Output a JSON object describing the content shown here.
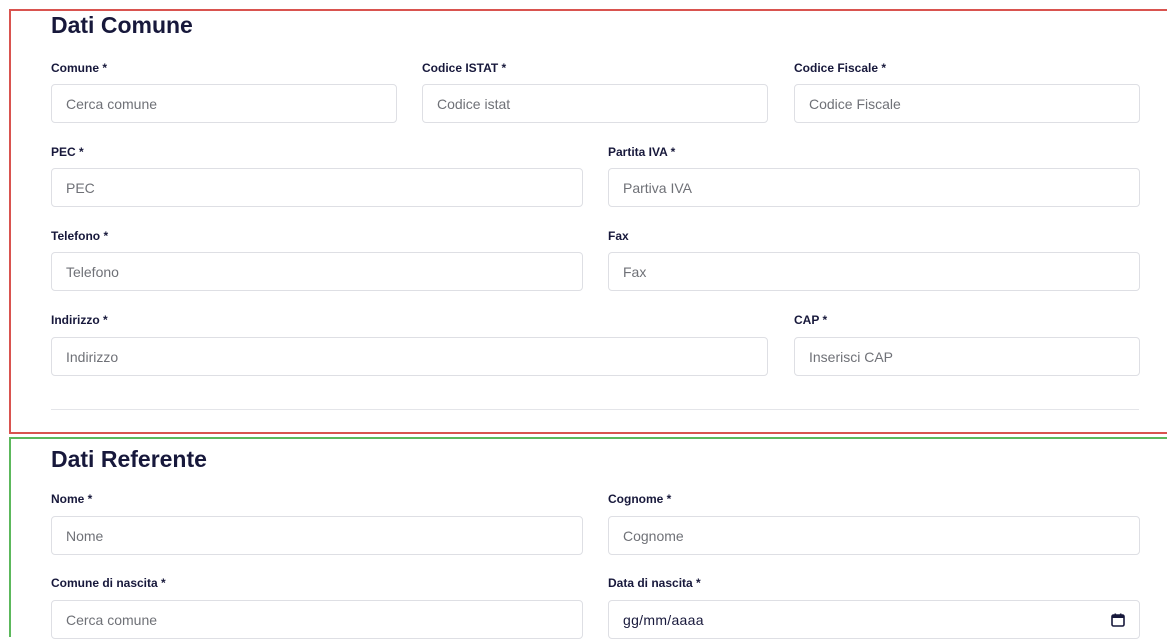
{
  "dati_comune": {
    "title": "Dati Comune",
    "comune": {
      "label": "Comune *",
      "placeholder": "Cerca comune"
    },
    "codice_istat": {
      "label": "Codice ISTAT *",
      "placeholder": "Codice istat"
    },
    "codice_fiscale": {
      "label": "Codice Fiscale *",
      "placeholder": "Codice Fiscale"
    },
    "pec": {
      "label": "PEC *",
      "placeholder": "PEC"
    },
    "partita_iva": {
      "label": "Partita IVA *",
      "placeholder": "Partiva IVA"
    },
    "telefono": {
      "label": "Telefono *",
      "placeholder": "Telefono"
    },
    "fax": {
      "label": "Fax",
      "placeholder": "Fax"
    },
    "indirizzo": {
      "label": "Indirizzo *",
      "placeholder": "Indirizzo"
    },
    "cap": {
      "label": "CAP *",
      "placeholder": "Inserisci CAP"
    }
  },
  "dati_referente": {
    "title": "Dati Referente",
    "nome": {
      "label": "Nome *",
      "placeholder": "Nome"
    },
    "cognome": {
      "label": "Cognome *",
      "placeholder": "Cognome"
    },
    "comune_nascita": {
      "label": "Comune di nascita *",
      "placeholder": "Cerca comune"
    },
    "data_nascita": {
      "label": "Data di nascita *",
      "value": "gg/mm/aaaa",
      "icon": "calendar-icon"
    }
  },
  "colors": {
    "section_comune_border": "#d9534f",
    "section_referente_border": "#5cb85c",
    "text_primary": "#17183b",
    "placeholder": "#6f7177",
    "input_border": "#dedfe4"
  }
}
